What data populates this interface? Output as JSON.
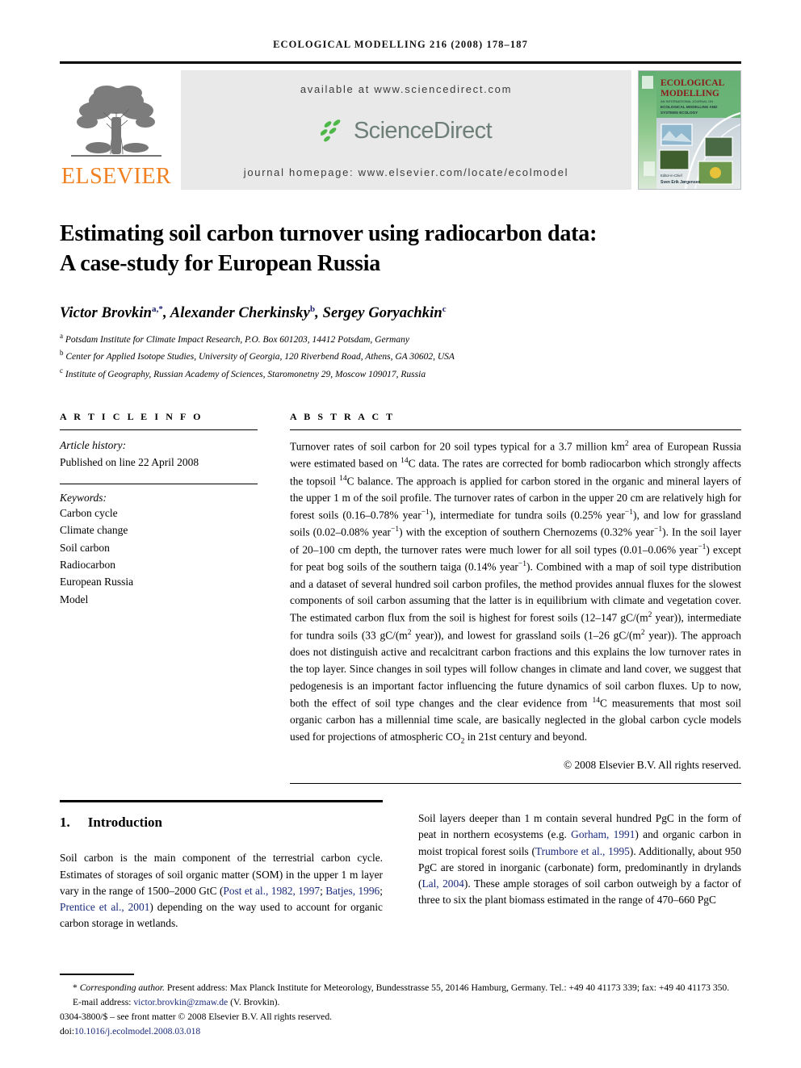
{
  "running_head": "Ecological Modelling 216 (2008) 178–187",
  "masthead": {
    "publisher_name": "ELSEVIER",
    "available_at": "available at www.sciencedirect.com",
    "sciencedirect_label": "ScienceDirect",
    "journal_homepage": "journal homepage: www.elsevier.com/locate/ecolmodel",
    "cover": {
      "line1": "ECOLOGICAL",
      "line2": "MODELLING",
      "line3": "AN INTERNATIONAL JOURNAL ON",
      "line4": "ECOLOGICAL MODELLING AND",
      "line5": "SYSTEMS ECOLOGY",
      "editor_label": "Editor-in-Chief",
      "editor_name": "Sven Erik Jørgensen"
    },
    "colors": {
      "elsevier_orange": "#F08020",
      "sciencedirect_green": "#4DB848",
      "sciencedirect_gray": "#6e7f78",
      "banner_bg": "#e9e9e9",
      "link_blue": "#1a2a7a"
    }
  },
  "article": {
    "title_line1": "Estimating soil carbon turnover using radiocarbon data:",
    "title_line2": "A case-study for European Russia",
    "authors": [
      {
        "name": "Victor Brovkin",
        "sup": "a",
        "star": "*"
      },
      {
        "name": "Alexander Cherkinsky",
        "sup": "b",
        "star": ""
      },
      {
        "name": "Sergey Goryachkin",
        "sup": "c",
        "star": ""
      }
    ],
    "affiliations": [
      {
        "mark": "a",
        "text": "Potsdam Institute for Climate Impact Research, P.O. Box 601203, 14412 Potsdam, Germany"
      },
      {
        "mark": "b",
        "text": "Center for Applied Isotope Studies, University of Georgia, 120 Riverbend Road, Athens, GA 30602, USA"
      },
      {
        "mark": "c",
        "text": "Institute of Geography, Russian Academy of Sciences, Staromonetny 29, Moscow 109017, Russia"
      }
    ]
  },
  "article_info": {
    "heading": "A R T I C L E   I N F O",
    "history_label": "Article history:",
    "history_value": "Published on line 22 April 2008",
    "keywords_label": "Keywords:",
    "keywords": [
      "Carbon cycle",
      "Climate change",
      "Soil carbon",
      "Radiocarbon",
      "European Russia",
      "Model"
    ]
  },
  "abstract": {
    "heading": "A B S T R A C T",
    "text_part1": "Turnover rates of soil carbon for 20 soil types typical for a 3.7 million km",
    "sup_km2": "2",
    "text_part2": " area of European Russia were estimated based on ",
    "sup_14a": "14",
    "text_part3": "C data. The rates are corrected for bomb radiocarbon which strongly affects the topsoil ",
    "sup_14b": "14",
    "text_part4": "C balance. The approach is applied for carbon stored in the organic and mineral layers of the upper 1 m of the soil profile. The turnover rates of carbon in the upper 20 cm are relatively high for forest soils (0.16–0.78% year",
    "sup_m1a": "−1",
    "text_part5": "), intermediate for tundra soils (0.25% year",
    "sup_m1b": "−1",
    "text_part6": "), and low for grassland soils (0.02–0.08% year",
    "sup_m1c": "−1",
    "text_part7": ") with the exception of southern Chernozems (0.32% year",
    "sup_m1d": "−1",
    "text_part8": "). In the soil layer of 20–100 cm depth, the turnover rates were much lower for all soil types (0.01–0.06% year",
    "sup_m1e": "−1",
    "text_part9": ") except for peat bog soils of the southern taiga (0.14% year",
    "sup_m1f": "−1",
    "text_part10": "). Combined with a map of soil type distribution and a dataset of several hundred soil carbon profiles, the method provides annual fluxes for the slowest components of soil carbon assuming that the latter is in equilibrium with climate and vegetation cover. The estimated carbon flux from the soil is highest for forest soils (12–147 gC/(m",
    "sup_m2a": "2",
    "text_part11": " year)), intermediate for tundra soils (33 gC/(m",
    "sup_m2b": "2",
    "text_part12": " year)), and lowest for grassland soils (1–26 gC/(m",
    "sup_m2c": "2",
    "text_part13": " year)). The approach does not distinguish active and recalcitrant carbon fractions and this explains the low turnover rates in the top layer. Since changes in soil types will follow changes in climate and land cover, we suggest that pedogenesis is an important factor influencing the future dynamics of soil carbon fluxes. Up to now, both the effect of soil type changes and the clear evidence from ",
    "sup_14c": "14",
    "text_part14": "C measurements that most soil organic carbon has a millennial time scale, are basically neglected in the global carbon cycle models used for projections of atmospheric CO",
    "sub_2": "2",
    "text_part15": " in 21st century and beyond.",
    "copyright": "© 2008 Elsevier B.V. All rights reserved."
  },
  "section": {
    "number": "1.",
    "title": "Introduction"
  },
  "body": {
    "left_part1": "Soil carbon is the main component of the terrestrial carbon cycle. Estimates of storages of soil organic matter (SOM) in the upper 1 m layer vary in the range of 1500–2000 GtC (",
    "left_ref1": "Post et al., 1982, 1997",
    "left_sep1": "; ",
    "left_ref2": "Batjes, 1996",
    "left_sep2": "; ",
    "left_ref3": "Prentice et al., 2001",
    "left_part2": ") depending on the way used to account for organic carbon storage in wetlands.",
    "right_part1": "Soil layers deeper than 1 m contain several hundred PgC in the form of peat in northern ecosystems (e.g. ",
    "right_ref1": "Gorham, 1991",
    "right_part2": ") and organic carbon in moist tropical forest soils (",
    "right_ref2": "Trumbore et al., 1995",
    "right_part3": "). Additionally, about 950 PgC are stored in inorganic (carbonate) form, predominantly in drylands (",
    "right_ref3": "Lal, 2004",
    "right_part4": "). These ample storages of soil carbon outweigh by a factor of three to six the plant biomass estimated in the range of 470–660 PgC"
  },
  "footnotes": {
    "corresponding_mark": "*",
    "corresponding_label": "Corresponding author.",
    "corresponding_text": " Present address: Max Planck Institute for Meteorology, Bundesstrasse 55, 20146 Hamburg, Germany. Tel.: +49 40 41173 339; fax: +49 40 41173 350.",
    "email_label": "E-mail address:",
    "email": "victor.brovkin@zmaw.de",
    "email_suffix": " (V. Brovkin).",
    "issn_line": "0304-3800/$ – see front matter © 2008 Elsevier B.V. All rights reserved.",
    "doi_label": "doi:",
    "doi": "10.1016/j.ecolmodel.2008.03.018"
  }
}
